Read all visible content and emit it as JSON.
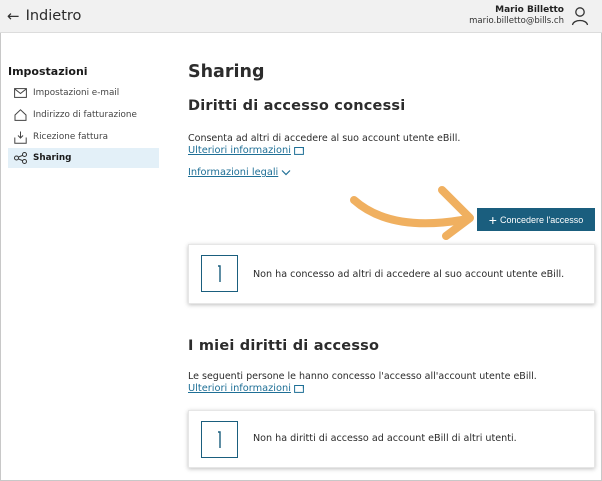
{
  "header": {
    "back_label": "Indietro",
    "user_name": "Mario Billetto",
    "user_email": "mario.billetto@bills.ch"
  },
  "sidebar": {
    "title": "Impostazioni",
    "items": [
      {
        "label": "Impostazioni e-mail",
        "icon": "mail-icon"
      },
      {
        "label": "Indirizzo di fatturazione",
        "icon": "home-icon"
      },
      {
        "label": "Ricezione fattura",
        "icon": "inbox-icon"
      },
      {
        "label": "Sharing",
        "icon": "share-icon",
        "active": true
      }
    ]
  },
  "main": {
    "title": "Sharing",
    "granted": {
      "heading": "Diritti di accesso concessi",
      "description": "Consenta ad altri di accedere al suo account utente eBill.",
      "more_info": "Ulteriori informazioni",
      "legal_info": "Informazioni legali",
      "grant_button": "Concedere l'accesso",
      "empty_message": "Non ha concesso ad altri di accedere al suo account utente eBill."
    },
    "mine": {
      "heading": "I miei diritti di accesso",
      "description": "Le seguenti persone le hanno concesso l'accesso all'account utente eBill.",
      "more_info": "Ulteriori informazioni",
      "empty_message": "Non ha diritti di accesso ad account eBill di altri utenti."
    }
  },
  "colors": {
    "accent": "#1a5e7e",
    "link": "#1e6f96",
    "arrow": "#f0b060",
    "active_bg": "#e3f0f8"
  }
}
